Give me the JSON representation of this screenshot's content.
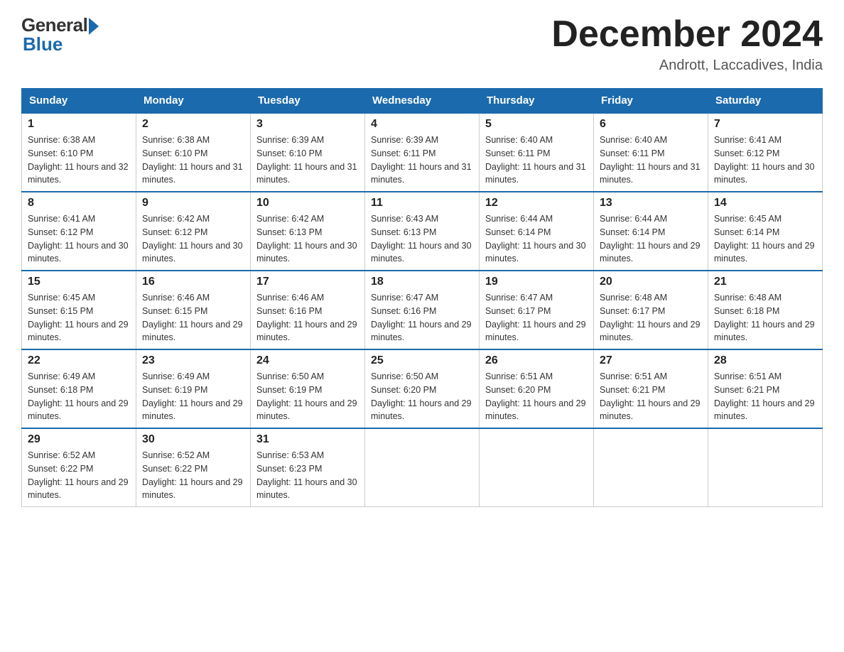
{
  "header": {
    "logo_general": "General",
    "logo_blue": "Blue",
    "month_title": "December 2024",
    "location": "Andrott, Laccadives, India"
  },
  "days_of_week": [
    "Sunday",
    "Monday",
    "Tuesday",
    "Wednesday",
    "Thursday",
    "Friday",
    "Saturday"
  ],
  "weeks": [
    [
      {
        "day": "1",
        "sunrise": "6:38 AM",
        "sunset": "6:10 PM",
        "daylight": "11 hours and 32 minutes."
      },
      {
        "day": "2",
        "sunrise": "6:38 AM",
        "sunset": "6:10 PM",
        "daylight": "11 hours and 31 minutes."
      },
      {
        "day": "3",
        "sunrise": "6:39 AM",
        "sunset": "6:10 PM",
        "daylight": "11 hours and 31 minutes."
      },
      {
        "day": "4",
        "sunrise": "6:39 AM",
        "sunset": "6:11 PM",
        "daylight": "11 hours and 31 minutes."
      },
      {
        "day": "5",
        "sunrise": "6:40 AM",
        "sunset": "6:11 PM",
        "daylight": "11 hours and 31 minutes."
      },
      {
        "day": "6",
        "sunrise": "6:40 AM",
        "sunset": "6:11 PM",
        "daylight": "11 hours and 31 minutes."
      },
      {
        "day": "7",
        "sunrise": "6:41 AM",
        "sunset": "6:12 PM",
        "daylight": "11 hours and 30 minutes."
      }
    ],
    [
      {
        "day": "8",
        "sunrise": "6:41 AM",
        "sunset": "6:12 PM",
        "daylight": "11 hours and 30 minutes."
      },
      {
        "day": "9",
        "sunrise": "6:42 AM",
        "sunset": "6:12 PM",
        "daylight": "11 hours and 30 minutes."
      },
      {
        "day": "10",
        "sunrise": "6:42 AM",
        "sunset": "6:13 PM",
        "daylight": "11 hours and 30 minutes."
      },
      {
        "day": "11",
        "sunrise": "6:43 AM",
        "sunset": "6:13 PM",
        "daylight": "11 hours and 30 minutes."
      },
      {
        "day": "12",
        "sunrise": "6:44 AM",
        "sunset": "6:14 PM",
        "daylight": "11 hours and 30 minutes."
      },
      {
        "day": "13",
        "sunrise": "6:44 AM",
        "sunset": "6:14 PM",
        "daylight": "11 hours and 29 minutes."
      },
      {
        "day": "14",
        "sunrise": "6:45 AM",
        "sunset": "6:14 PM",
        "daylight": "11 hours and 29 minutes."
      }
    ],
    [
      {
        "day": "15",
        "sunrise": "6:45 AM",
        "sunset": "6:15 PM",
        "daylight": "11 hours and 29 minutes."
      },
      {
        "day": "16",
        "sunrise": "6:46 AM",
        "sunset": "6:15 PM",
        "daylight": "11 hours and 29 minutes."
      },
      {
        "day": "17",
        "sunrise": "6:46 AM",
        "sunset": "6:16 PM",
        "daylight": "11 hours and 29 minutes."
      },
      {
        "day": "18",
        "sunrise": "6:47 AM",
        "sunset": "6:16 PM",
        "daylight": "11 hours and 29 minutes."
      },
      {
        "day": "19",
        "sunrise": "6:47 AM",
        "sunset": "6:17 PM",
        "daylight": "11 hours and 29 minutes."
      },
      {
        "day": "20",
        "sunrise": "6:48 AM",
        "sunset": "6:17 PM",
        "daylight": "11 hours and 29 minutes."
      },
      {
        "day": "21",
        "sunrise": "6:48 AM",
        "sunset": "6:18 PM",
        "daylight": "11 hours and 29 minutes."
      }
    ],
    [
      {
        "day": "22",
        "sunrise": "6:49 AM",
        "sunset": "6:18 PM",
        "daylight": "11 hours and 29 minutes."
      },
      {
        "day": "23",
        "sunrise": "6:49 AM",
        "sunset": "6:19 PM",
        "daylight": "11 hours and 29 minutes."
      },
      {
        "day": "24",
        "sunrise": "6:50 AM",
        "sunset": "6:19 PM",
        "daylight": "11 hours and 29 minutes."
      },
      {
        "day": "25",
        "sunrise": "6:50 AM",
        "sunset": "6:20 PM",
        "daylight": "11 hours and 29 minutes."
      },
      {
        "day": "26",
        "sunrise": "6:51 AM",
        "sunset": "6:20 PM",
        "daylight": "11 hours and 29 minutes."
      },
      {
        "day": "27",
        "sunrise": "6:51 AM",
        "sunset": "6:21 PM",
        "daylight": "11 hours and 29 minutes."
      },
      {
        "day": "28",
        "sunrise": "6:51 AM",
        "sunset": "6:21 PM",
        "daylight": "11 hours and 29 minutes."
      }
    ],
    [
      {
        "day": "29",
        "sunrise": "6:52 AM",
        "sunset": "6:22 PM",
        "daylight": "11 hours and 29 minutes."
      },
      {
        "day": "30",
        "sunrise": "6:52 AM",
        "sunset": "6:22 PM",
        "daylight": "11 hours and 29 minutes."
      },
      {
        "day": "31",
        "sunrise": "6:53 AM",
        "sunset": "6:23 PM",
        "daylight": "11 hours and 30 minutes."
      },
      null,
      null,
      null,
      null
    ]
  ]
}
